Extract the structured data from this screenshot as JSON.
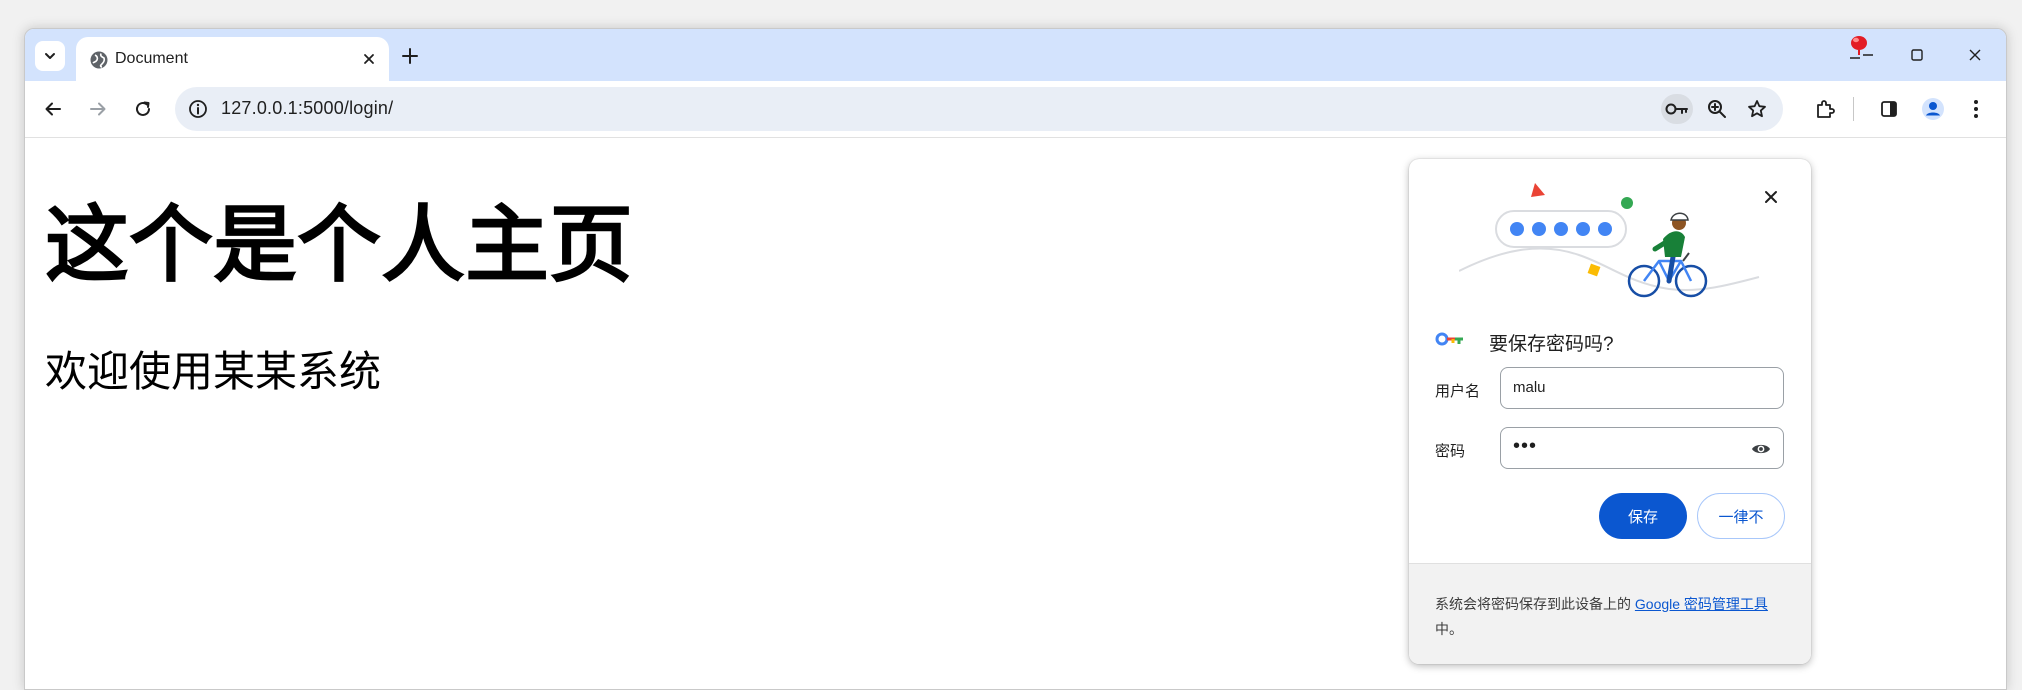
{
  "browser": {
    "tab": {
      "title": "Document"
    },
    "new_tab_symbol": "+",
    "address_bar": {
      "url": "127.0.0.1:5000/login/"
    },
    "icons": [
      "tab-search-icon",
      "globe-icon",
      "close-icon",
      "plus-icon",
      "minimize-icon",
      "maximize-icon",
      "close-window-icon",
      "back-icon",
      "forward-icon",
      "reload-icon",
      "info-icon",
      "key-icon",
      "zoom-icon",
      "star-icon",
      "extensions-icon",
      "side-panel-icon",
      "profile-icon",
      "more-icon"
    ]
  },
  "page": {
    "heading": "这个是个人主页",
    "welcome": "欢迎使用某某系统"
  },
  "password_bubble": {
    "title": "要保存密码吗?",
    "username_label": "用户名",
    "username_value": "malu",
    "password_label": "密码",
    "password_mask": "•••",
    "save_label": "保存",
    "never_label": "一律不",
    "footer_prefix": "系统会将密码保存到此设备上的",
    "footer_link": "Google 密码管理工具",
    "footer_suffix": "中。"
  },
  "colors": {
    "accent": "#0b57d0",
    "tabstrip": "#d3e3fd",
    "omnibox": "#e9eef6"
  }
}
